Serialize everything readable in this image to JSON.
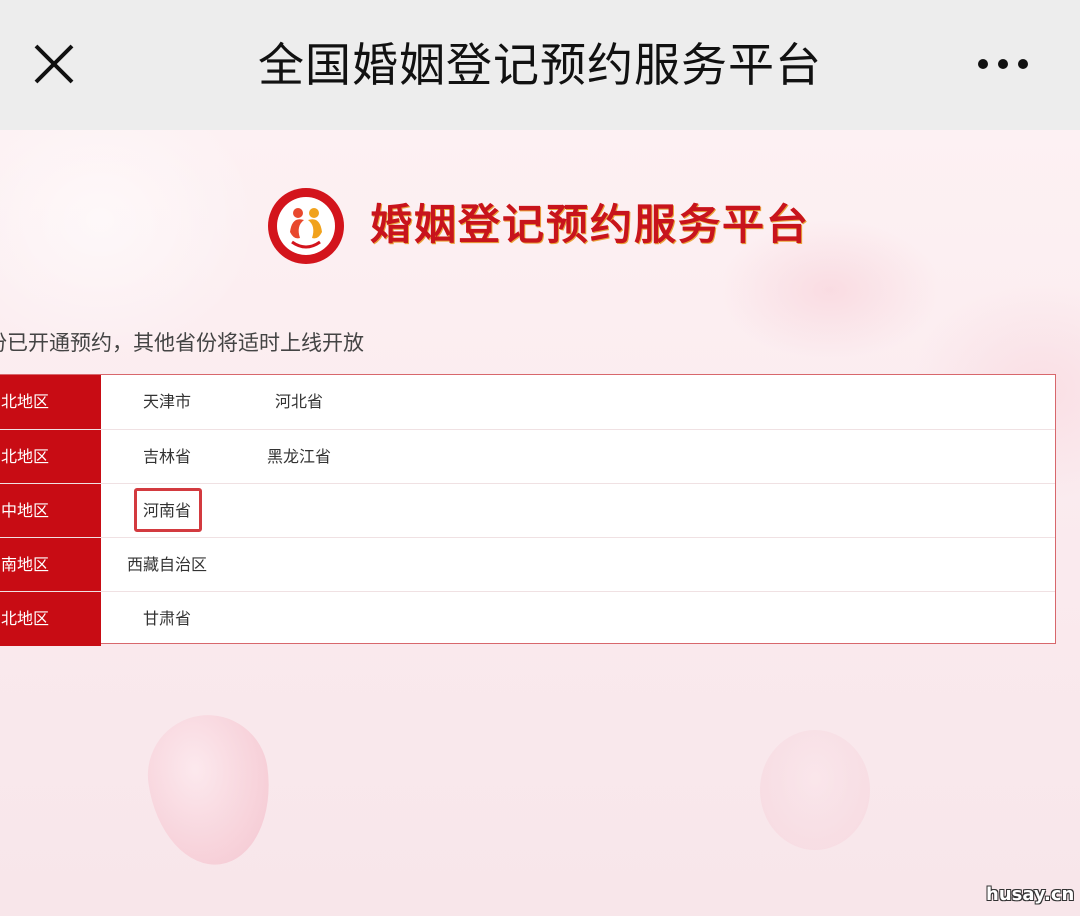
{
  "header": {
    "title": "全国婚姻登记预约服务平台",
    "close_icon": "close-icon",
    "more_icon": "more-icon"
  },
  "brand": {
    "title": "婚姻登记预约服务平台",
    "logo_icon": "marriage-registration-logo"
  },
  "notice": "份已开通预约，其他省份将适时上线开放",
  "regions": [
    {
      "label": "华北地区",
      "shown": "北地区",
      "provinces": [
        "天津市",
        "河北省"
      ]
    },
    {
      "label": "东北地区",
      "shown": "北地区",
      "provinces": [
        "吉林省",
        "黑龙江省"
      ]
    },
    {
      "label": "华中地区",
      "shown": "中地区",
      "provinces": [
        "河南省"
      ]
    },
    {
      "label": "西南地区",
      "shown": "南地区",
      "provinces": [
        "西藏自治区"
      ]
    },
    {
      "label": "西北地区",
      "shown": "北地区",
      "provinces": [
        "甘肃省"
      ]
    }
  ],
  "watermark": "husay.cn",
  "colors": {
    "accent": "#c80c14",
    "topbar": "#ededed",
    "background": "#fbeef1"
  }
}
